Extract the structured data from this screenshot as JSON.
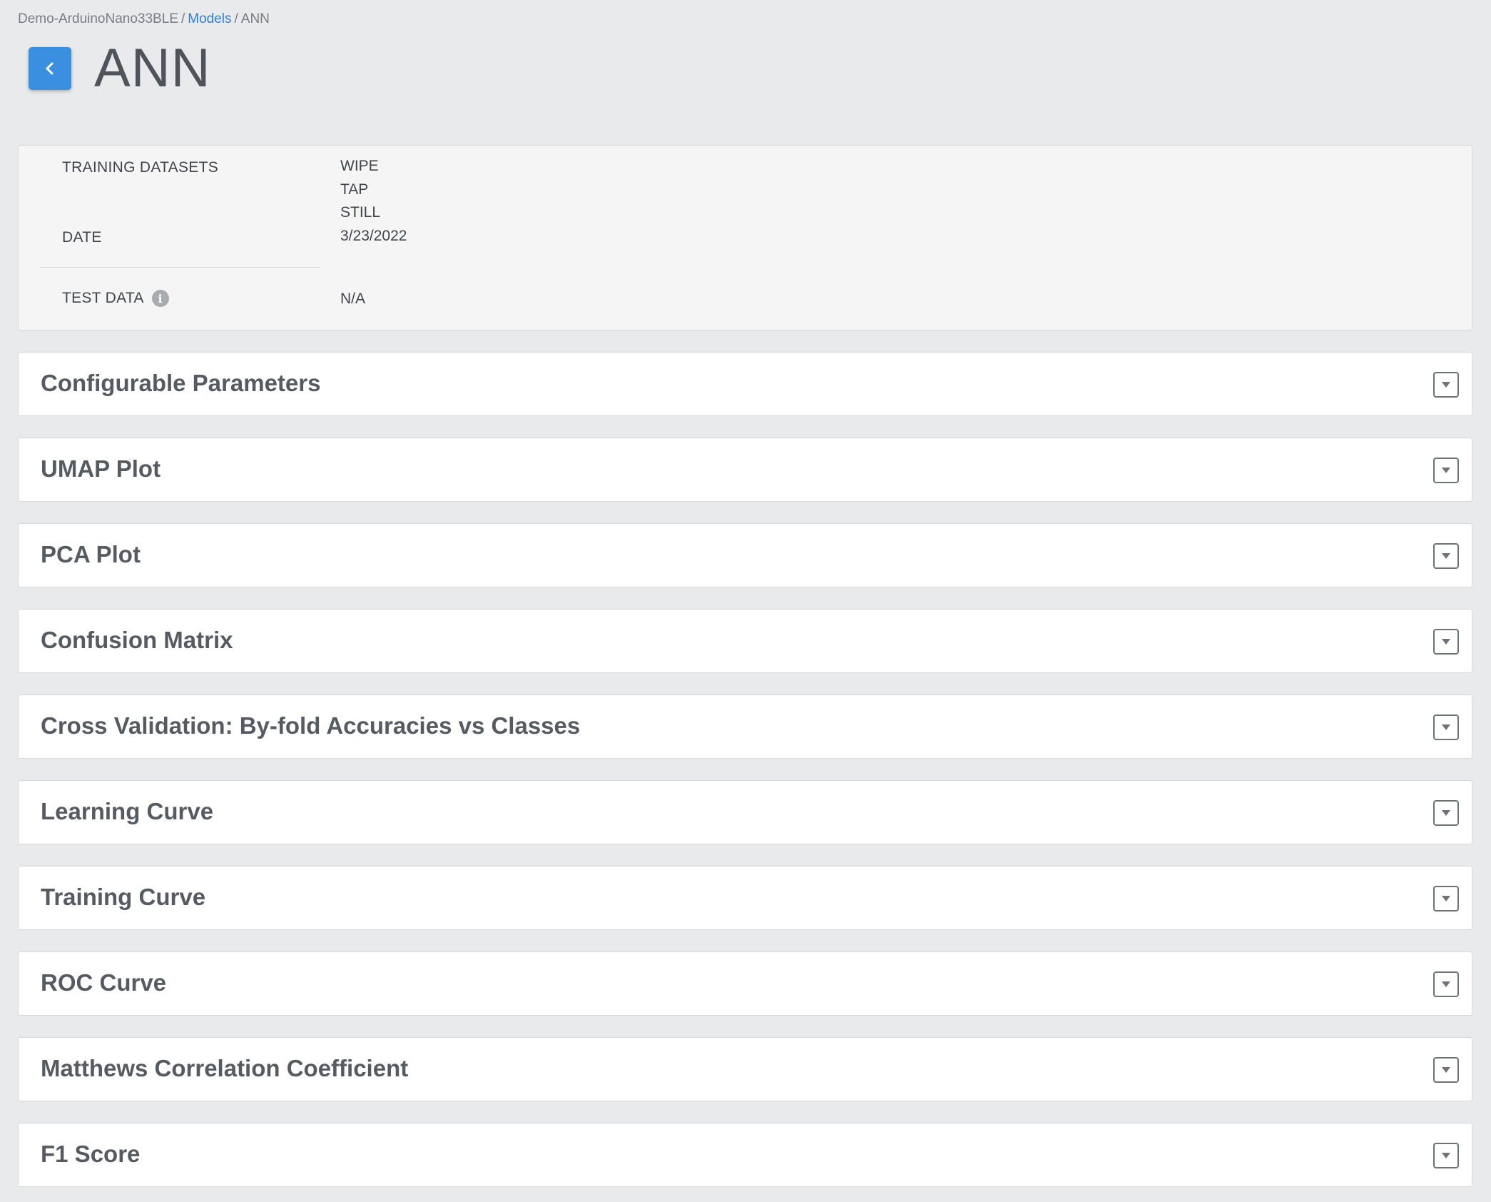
{
  "breadcrumb": {
    "project": "Demo-ArduinoNano33BLE",
    "separator": "/",
    "models": "Models",
    "current": "ANN"
  },
  "header": {
    "title": "ANN",
    "back_icon": "chevron-left-icon"
  },
  "info": {
    "training_datasets_label": "TRAINING DATASETS",
    "training_datasets": [
      "WIPE",
      "TAP",
      "STILL"
    ],
    "date_label": "DATE",
    "date": "3/23/2022",
    "test_data_label": "TEST DATA",
    "test_data": "N/A",
    "info_icon": "info-icon"
  },
  "sections": [
    {
      "title": "Configurable Parameters"
    },
    {
      "title": "UMAP Plot"
    },
    {
      "title": "PCA Plot"
    },
    {
      "title": "Confusion Matrix"
    },
    {
      "title": "Cross Validation: By-fold Accuracies vs Classes"
    },
    {
      "title": "Learning Curve"
    },
    {
      "title": "Training Curve"
    },
    {
      "title": "ROC Curve"
    },
    {
      "title": "Matthews Correlation Coefficient"
    },
    {
      "title": "F1 Score"
    }
  ],
  "colors": {
    "background": "#e9eaec",
    "accent": "#3b8fe0",
    "link": "#2f7fd6",
    "card": "#ffffff",
    "panel": "#f5f5f5"
  }
}
